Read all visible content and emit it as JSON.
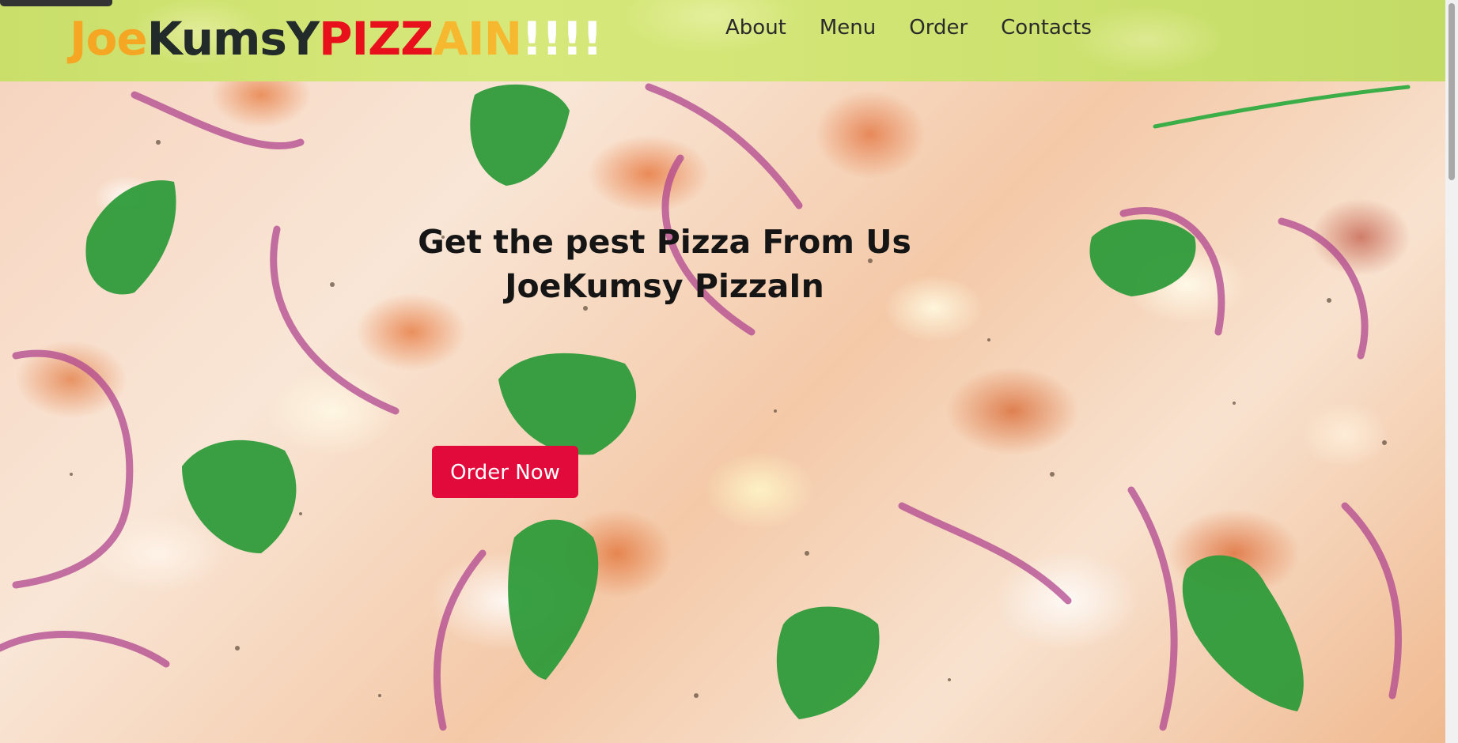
{
  "header": {
    "logo_parts": [
      {
        "text": "Joe",
        "color": "#f5a623"
      },
      {
        "text": "KumsY",
        "color": "#222a2a"
      },
      {
        "text": "PIZZ",
        "color": "#e8101b"
      },
      {
        "text": "AIN",
        "color": "#f5b82e"
      },
      {
        "text": "!!!!",
        "color": "#ffffff"
      }
    ],
    "nav": [
      "About",
      "Menu",
      "Order",
      "Contacts"
    ]
  },
  "hero": {
    "title_line1": "Get the pest Pizza From Us",
    "title_line2": "JoeKumsy PizzaIn",
    "cta_label": "Order Now",
    "background_icon": "pizza-photo"
  },
  "colors": {
    "header_bg": "#cfe372",
    "cta_bg": "#e20a3b",
    "cta_text": "#ffffff",
    "title_text": "#151515"
  }
}
